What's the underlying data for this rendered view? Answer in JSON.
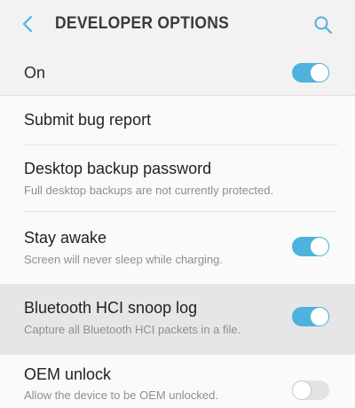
{
  "header": {
    "title": "DEVELOPER OPTIONS",
    "back_icon": "chevron-left-icon",
    "search_icon": "search-icon"
  },
  "master_switch": {
    "label": "On",
    "state": "on"
  },
  "settings": [
    {
      "title": "Submit bug report",
      "subtitle": "",
      "toggle": "none"
    },
    {
      "title": "Desktop backup password",
      "subtitle": "Full desktop backups are not currently protected.",
      "toggle": "none"
    },
    {
      "title": "Stay awake",
      "subtitle": "Screen will never sleep while charging.",
      "toggle": "on"
    },
    {
      "title": "Bluetooth HCI snoop log",
      "subtitle": "Capture all Bluetooth HCI packets in a file.",
      "toggle": "on",
      "highlighted": true
    },
    {
      "title": "OEM unlock",
      "subtitle": "Allow the device to be OEM unlocked.",
      "toggle": "off"
    }
  ],
  "colors": {
    "accent": "#4fb2dc",
    "title_text": "#3a3a3a",
    "subtitle_text": "#8e8e8e"
  }
}
